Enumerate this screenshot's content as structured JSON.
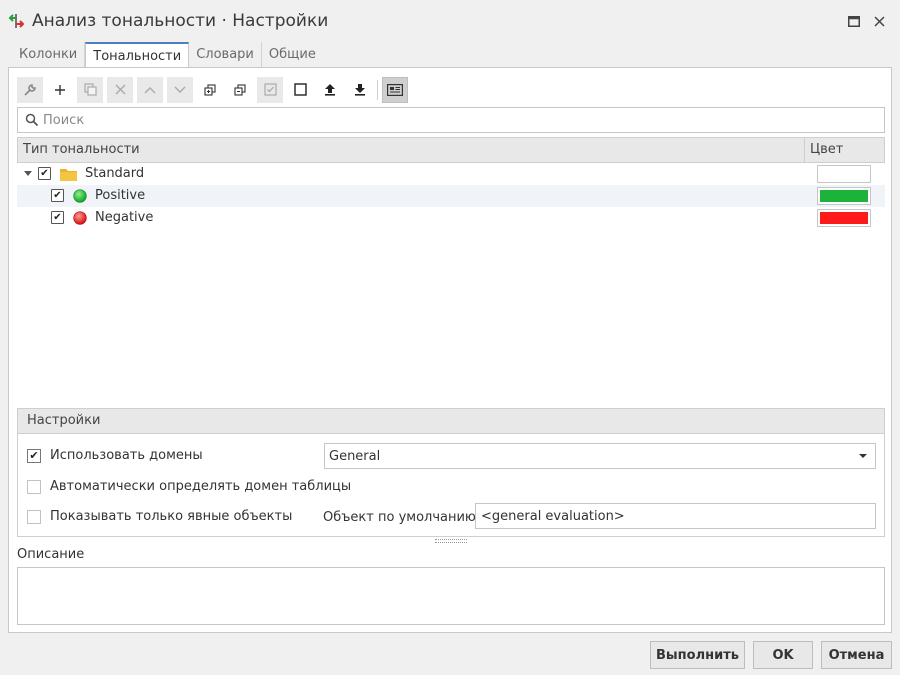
{
  "window": {
    "title": "Анализ тональности · Настройки"
  },
  "tabs": [
    {
      "label": "Колонки",
      "active": false
    },
    {
      "label": "Тональности",
      "active": true
    },
    {
      "label": "Словари",
      "active": false
    },
    {
      "label": "Общие",
      "active": false
    }
  ],
  "toolbar": {
    "buttons": [
      "wrench-icon",
      "plus-icon",
      "duplicate-icon",
      "delete-icon",
      "move-up-icon",
      "move-down-icon",
      "expand-all-icon",
      "collapse-all-icon",
      "check-all-icon",
      "uncheck-all-icon",
      "import-icon",
      "export-icon",
      "view-icon"
    ]
  },
  "search": {
    "placeholder": "Поиск"
  },
  "grid": {
    "columns": [
      "Тип тональности",
      "Цвет"
    ],
    "rows": [
      {
        "label": "Standard",
        "checked": true,
        "level": 0,
        "icon": "folder-icon",
        "color": "#ffffff"
      },
      {
        "label": "Positive",
        "checked": true,
        "level": 1,
        "icon": "green-dot-icon",
        "color": "#1bb33a"
      },
      {
        "label": "Negative",
        "checked": true,
        "level": 1,
        "icon": "red-dot-icon",
        "color": "#ff1a1a"
      }
    ]
  },
  "settings": {
    "header": "Настройки",
    "use_domains": {
      "label": "Использовать домены",
      "checked": true
    },
    "domain_select": {
      "value": "General"
    },
    "auto_detect": {
      "label": "Автоматически определять домен таблицы",
      "checked": false
    },
    "explicit_only": {
      "label": "Показывать только явные объекты",
      "checked": false
    },
    "default_object": {
      "label": "Объект по умолчанию",
      "value": "<general evaluation>"
    }
  },
  "description": {
    "label": "Описание",
    "value": ""
  },
  "buttons": {
    "run": "Выполнить",
    "ok": "OK",
    "cancel": "Отмена"
  },
  "colors": {
    "accent": "#4a7fc1",
    "positive": "#1bb33a",
    "negative": "#ff1a1a",
    "folder": "#f5c542"
  }
}
